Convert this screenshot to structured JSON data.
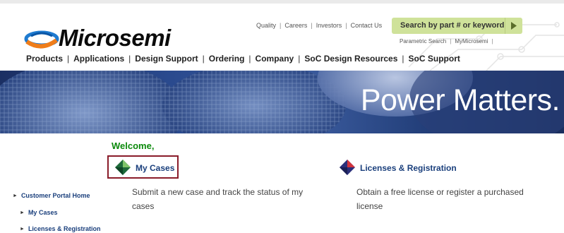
{
  "brand": {
    "name": "Microsemi"
  },
  "utility_nav": [
    "Quality",
    "Careers",
    "Investors",
    "Contact Us"
  ],
  "search": {
    "label": "Search by part # or keyword"
  },
  "utility_nav2": [
    "Parametric Search",
    "MyMicrosemi"
  ],
  "main_nav": [
    "Products",
    "Applications",
    "Design Support",
    "Ordering",
    "Company",
    "SoC Design Resources",
    "SoC Support"
  ],
  "banner": {
    "title": "Power Matters."
  },
  "welcome": "Welcome,",
  "cards": [
    {
      "title": "My Cases",
      "description_line1": "Submit a new case and track the status of my",
      "description_line2": "cases"
    },
    {
      "title": "Licenses & Registration",
      "description_line1": "Obtain a free license or register a purchased",
      "description_line2": "license"
    }
  ],
  "sidebar": [
    {
      "label": "Customer Portal Home"
    },
    {
      "label": "My Cases"
    },
    {
      "label": "Licenses & Registration"
    }
  ],
  "colors": {
    "accent_green": "#0c8a0c",
    "link_blue": "#1a3f7c",
    "highlight_border": "#8a1c2a",
    "search_bg": "#cfe29a"
  }
}
